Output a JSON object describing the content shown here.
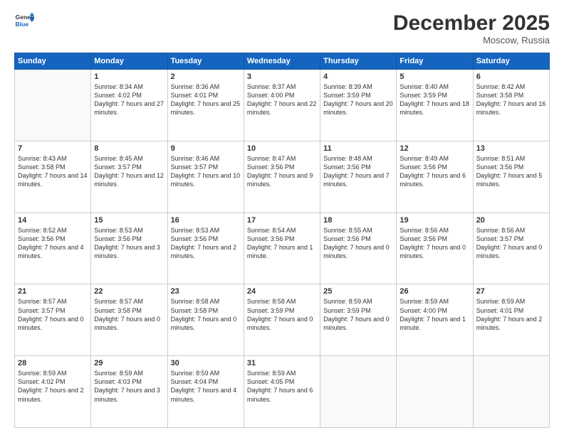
{
  "header": {
    "logo_line1": "General",
    "logo_line2": "Blue",
    "month": "December 2025",
    "location": "Moscow, Russia"
  },
  "weekdays": [
    "Sunday",
    "Monday",
    "Tuesday",
    "Wednesday",
    "Thursday",
    "Friday",
    "Saturday"
  ],
  "weeks": [
    [
      {
        "day": null
      },
      {
        "day": "1",
        "sunrise": "8:34 AM",
        "sunset": "4:02 PM",
        "daylight": "7 hours and 27 minutes."
      },
      {
        "day": "2",
        "sunrise": "8:36 AM",
        "sunset": "4:01 PM",
        "daylight": "7 hours and 25 minutes."
      },
      {
        "day": "3",
        "sunrise": "8:37 AM",
        "sunset": "4:00 PM",
        "daylight": "7 hours and 22 minutes."
      },
      {
        "day": "4",
        "sunrise": "8:39 AM",
        "sunset": "3:59 PM",
        "daylight": "7 hours and 20 minutes."
      },
      {
        "day": "5",
        "sunrise": "8:40 AM",
        "sunset": "3:59 PM",
        "daylight": "7 hours and 18 minutes."
      },
      {
        "day": "6",
        "sunrise": "8:42 AM",
        "sunset": "3:58 PM",
        "daylight": "7 hours and 16 minutes."
      }
    ],
    [
      {
        "day": "7",
        "sunrise": "8:43 AM",
        "sunset": "3:58 PM",
        "daylight": "7 hours and 14 minutes."
      },
      {
        "day": "8",
        "sunrise": "8:45 AM",
        "sunset": "3:57 PM",
        "daylight": "7 hours and 12 minutes."
      },
      {
        "day": "9",
        "sunrise": "8:46 AM",
        "sunset": "3:57 PM",
        "daylight": "7 hours and 10 minutes."
      },
      {
        "day": "10",
        "sunrise": "8:47 AM",
        "sunset": "3:56 PM",
        "daylight": "7 hours and 9 minutes."
      },
      {
        "day": "11",
        "sunrise": "8:48 AM",
        "sunset": "3:56 PM",
        "daylight": "7 hours and 7 minutes."
      },
      {
        "day": "12",
        "sunrise": "8:49 AM",
        "sunset": "3:56 PM",
        "daylight": "7 hours and 6 minutes."
      },
      {
        "day": "13",
        "sunrise": "8:51 AM",
        "sunset": "3:56 PM",
        "daylight": "7 hours and 5 minutes."
      }
    ],
    [
      {
        "day": "14",
        "sunrise": "8:52 AM",
        "sunset": "3:56 PM",
        "daylight": "7 hours and 4 minutes."
      },
      {
        "day": "15",
        "sunrise": "8:53 AM",
        "sunset": "3:56 PM",
        "daylight": "7 hours and 3 minutes."
      },
      {
        "day": "16",
        "sunrise": "8:53 AM",
        "sunset": "3:56 PM",
        "daylight": "7 hours and 2 minutes."
      },
      {
        "day": "17",
        "sunrise": "8:54 AM",
        "sunset": "3:56 PM",
        "daylight": "7 hours and 1 minute."
      },
      {
        "day": "18",
        "sunrise": "8:55 AM",
        "sunset": "3:56 PM",
        "daylight": "7 hours and 0 minutes."
      },
      {
        "day": "19",
        "sunrise": "8:56 AM",
        "sunset": "3:56 PM",
        "daylight": "7 hours and 0 minutes."
      },
      {
        "day": "20",
        "sunrise": "8:56 AM",
        "sunset": "3:57 PM",
        "daylight": "7 hours and 0 minutes."
      }
    ],
    [
      {
        "day": "21",
        "sunrise": "8:57 AM",
        "sunset": "3:57 PM",
        "daylight": "7 hours and 0 minutes."
      },
      {
        "day": "22",
        "sunrise": "8:57 AM",
        "sunset": "3:58 PM",
        "daylight": "7 hours and 0 minutes."
      },
      {
        "day": "23",
        "sunrise": "8:58 AM",
        "sunset": "3:58 PM",
        "daylight": "7 hours and 0 minutes."
      },
      {
        "day": "24",
        "sunrise": "8:58 AM",
        "sunset": "3:59 PM",
        "daylight": "7 hours and 0 minutes."
      },
      {
        "day": "25",
        "sunrise": "8:59 AM",
        "sunset": "3:59 PM",
        "daylight": "7 hours and 0 minutes."
      },
      {
        "day": "26",
        "sunrise": "8:59 AM",
        "sunset": "4:00 PM",
        "daylight": "7 hours and 1 minute."
      },
      {
        "day": "27",
        "sunrise": "8:59 AM",
        "sunset": "4:01 PM",
        "daylight": "7 hours and 2 minutes."
      }
    ],
    [
      {
        "day": "28",
        "sunrise": "8:59 AM",
        "sunset": "4:02 PM",
        "daylight": "7 hours and 2 minutes."
      },
      {
        "day": "29",
        "sunrise": "8:59 AM",
        "sunset": "4:03 PM",
        "daylight": "7 hours and 3 minutes."
      },
      {
        "day": "30",
        "sunrise": "8:59 AM",
        "sunset": "4:04 PM",
        "daylight": "7 hours and 4 minutes."
      },
      {
        "day": "31",
        "sunrise": "8:59 AM",
        "sunset": "4:05 PM",
        "daylight": "7 hours and 6 minutes."
      },
      {
        "day": null
      },
      {
        "day": null
      },
      {
        "day": null
      }
    ]
  ]
}
